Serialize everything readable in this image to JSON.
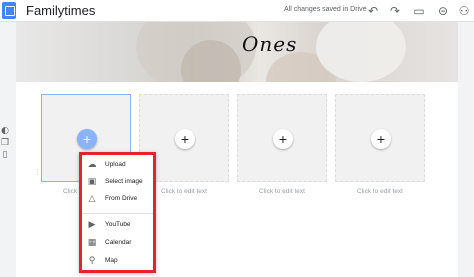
{
  "app": {
    "title": "Familytimes",
    "save_status": "All changes saved in Drive"
  },
  "toolbar": {
    "icons": [
      "undo-icon",
      "redo-icon",
      "preview-icon",
      "link-icon",
      "add-person-icon"
    ]
  },
  "page": {
    "title": "Ones"
  },
  "cards": [
    {
      "caption": "Click to edit text",
      "selected": true
    },
    {
      "caption": "Click to edit text",
      "selected": false
    },
    {
      "caption": "Click to edit text",
      "selected": false
    },
    {
      "caption": "Click to edit text",
      "selected": false
    }
  ],
  "insert_menu": {
    "items": [
      {
        "label": "Upload",
        "icon": "cloud-upload-icon"
      },
      {
        "label": "Select image",
        "icon": "image-icon"
      },
      {
        "label": "From Drive",
        "icon": "drive-icon"
      },
      {
        "label": "YouTube",
        "icon": "youtube-icon"
      },
      {
        "label": "Calendar",
        "icon": "calendar-icon"
      },
      {
        "label": "Map",
        "icon": "map-pin-icon"
      }
    ],
    "highlight_color": "#e3242b"
  }
}
